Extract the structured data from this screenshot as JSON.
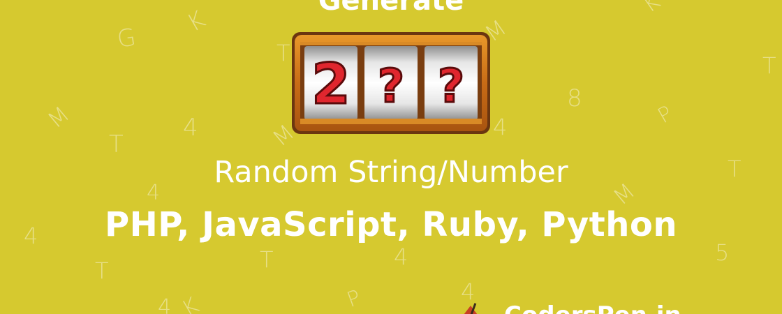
{
  "banner": {
    "title_top": "Generate",
    "subtitle": "Random String/Number",
    "languages": "PHP, JavaScript, Ruby, Python",
    "reels": [
      "2",
      "?",
      "?"
    ],
    "logo_text": "CodersPen.in",
    "background_color": "#d6c92f",
    "background_letters": [
      "G",
      "K",
      "T",
      "M",
      "T",
      "M",
      "4",
      "M",
      "T",
      "4",
      "8",
      "P",
      "T",
      "4",
      "4",
      "M",
      "4",
      "T",
      "T",
      "4",
      "P",
      "K",
      "K",
      "4",
      "5"
    ]
  }
}
